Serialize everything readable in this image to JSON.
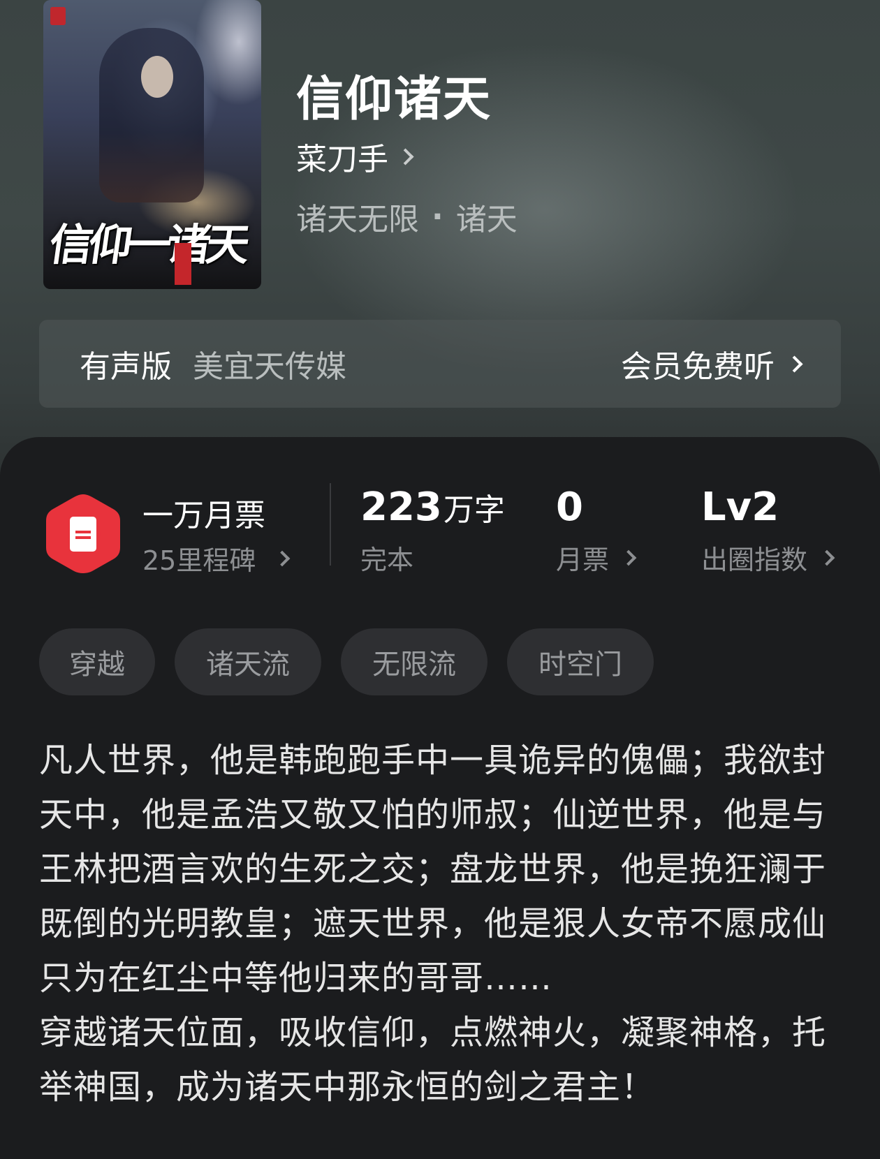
{
  "book": {
    "title": "信仰诸天",
    "author": "菜刀手",
    "category": "诸天无限",
    "subcategory": "诸天",
    "separator": "·"
  },
  "cover": {
    "title_art": "信仰一诸天"
  },
  "audio": {
    "label": "有声版",
    "publisher": "美宜天传媒",
    "action": "会员免费听"
  },
  "ticket": {
    "title": "一万月票",
    "subtitle": "25里程碑",
    "accent_color": "#e8333c"
  },
  "stats": {
    "words": {
      "value": "223",
      "unit": "万字",
      "label": "完本"
    },
    "monthly_votes": {
      "value": "0",
      "label": "月票"
    },
    "influence": {
      "value": "Lv2",
      "label": "出圈指数"
    }
  },
  "tags": [
    "穿越",
    "诸天流",
    "无限流",
    "时空门"
  ],
  "synopsis": {
    "p1": "凡人世界，他是韩跑跑手中一具诡异的傀儡；我欲封天中，他是孟浩又敬又怕的师叔；仙逆世界，他是与王林把酒言欢的生死之交；盘龙世界，他是挽狂澜于既倒的光明教皇；遮天世界，他是狠人女帝不愿成仙只为在红尘中等他归来的哥哥……",
    "p2": "穿越诸天位面，吸收信仰，点燃神火，凝聚神格，托举神国，成为诸天中那永恒的剑之君主！"
  }
}
